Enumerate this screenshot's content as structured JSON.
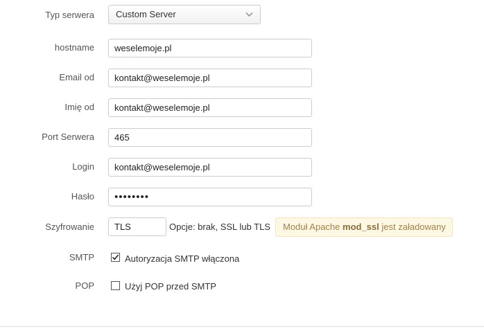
{
  "form": {
    "server_type": {
      "label": "Typ serwera",
      "value": "Custom Server"
    },
    "hostname": {
      "label": "hostname",
      "value": "weselemoje.pl"
    },
    "email_from": {
      "label": "Email od",
      "value": "kontakt@weselemoje.pl"
    },
    "name_from": {
      "label": "Imię od",
      "value": "kontakt@weselemoje.pl"
    },
    "port": {
      "label": "Port Serwera",
      "value": "465"
    },
    "login": {
      "label": "Login",
      "value": "kontakt@weselemoje.pl"
    },
    "password": {
      "label": "Hasło",
      "value": "••••••••"
    },
    "encryption": {
      "label": "Szyfrowanie",
      "value": "TLS",
      "hint": "Opcje: brak, SSL lub TLS",
      "notice_prefix": "Moduł Apache ",
      "notice_module": "mod_ssl",
      "notice_suffix": " jest załadowany"
    },
    "smtp": {
      "label": "SMTP",
      "checkbox_label": "Autoryzacja SMTP włączona",
      "checked": true
    },
    "pop": {
      "label": "POP",
      "checkbox_label": "Użyj POP przed SMTP",
      "checked": false
    }
  },
  "colors": {
    "notice_bg": "#fcf8e3",
    "notice_text": "#a2814a"
  },
  "icons": {
    "select_arrow": "chevron-down-icon",
    "check": "checkmark-icon"
  }
}
